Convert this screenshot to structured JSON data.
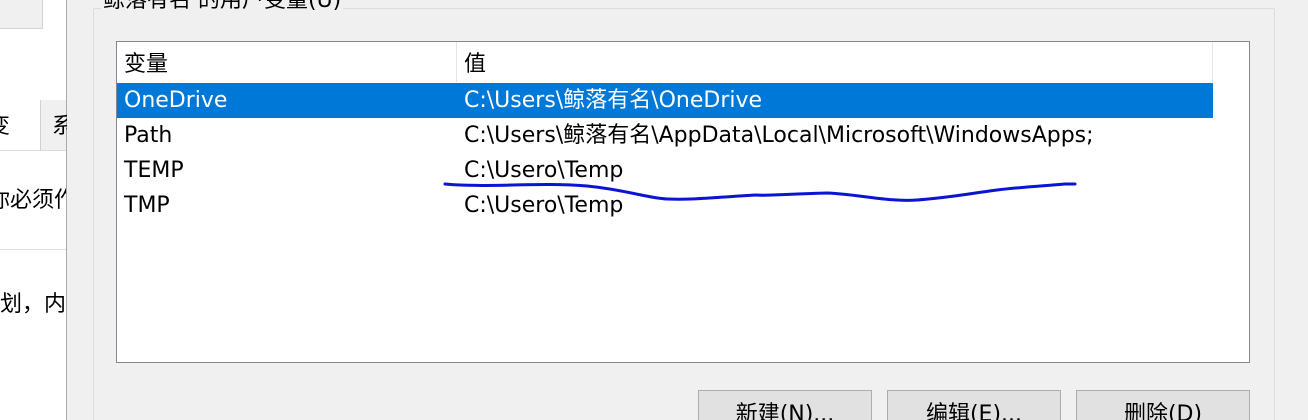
{
  "background_window": {
    "tab_1": "变",
    "tab_2": "系",
    "line_1": "你必须作",
    "line_2": "划，内"
  },
  "dialog": {
    "group_title": "鲸落有名 的用户变量(U)",
    "columns": [
      "变量",
      "值"
    ],
    "rows": [
      {
        "name": "OneDrive",
        "value": "C:\\Users\\鲸落有名\\OneDrive",
        "selected": true
      },
      {
        "name": "Path",
        "value": "C:\\Users\\鲸落有名\\AppData\\Local\\Microsoft\\WindowsApps;",
        "selected": false
      },
      {
        "name": "TEMP",
        "value": "C:\\Usero\\Temp",
        "selected": false
      },
      {
        "name": "TMP",
        "value": "C:\\Usero\\Temp",
        "selected": false
      }
    ],
    "buttons": {
      "new": "新建(N)...",
      "edit": "编辑(E)...",
      "delete": "删除(D)"
    },
    "selection_color": "#0078d7",
    "annotation_color": "#0a14d2"
  }
}
